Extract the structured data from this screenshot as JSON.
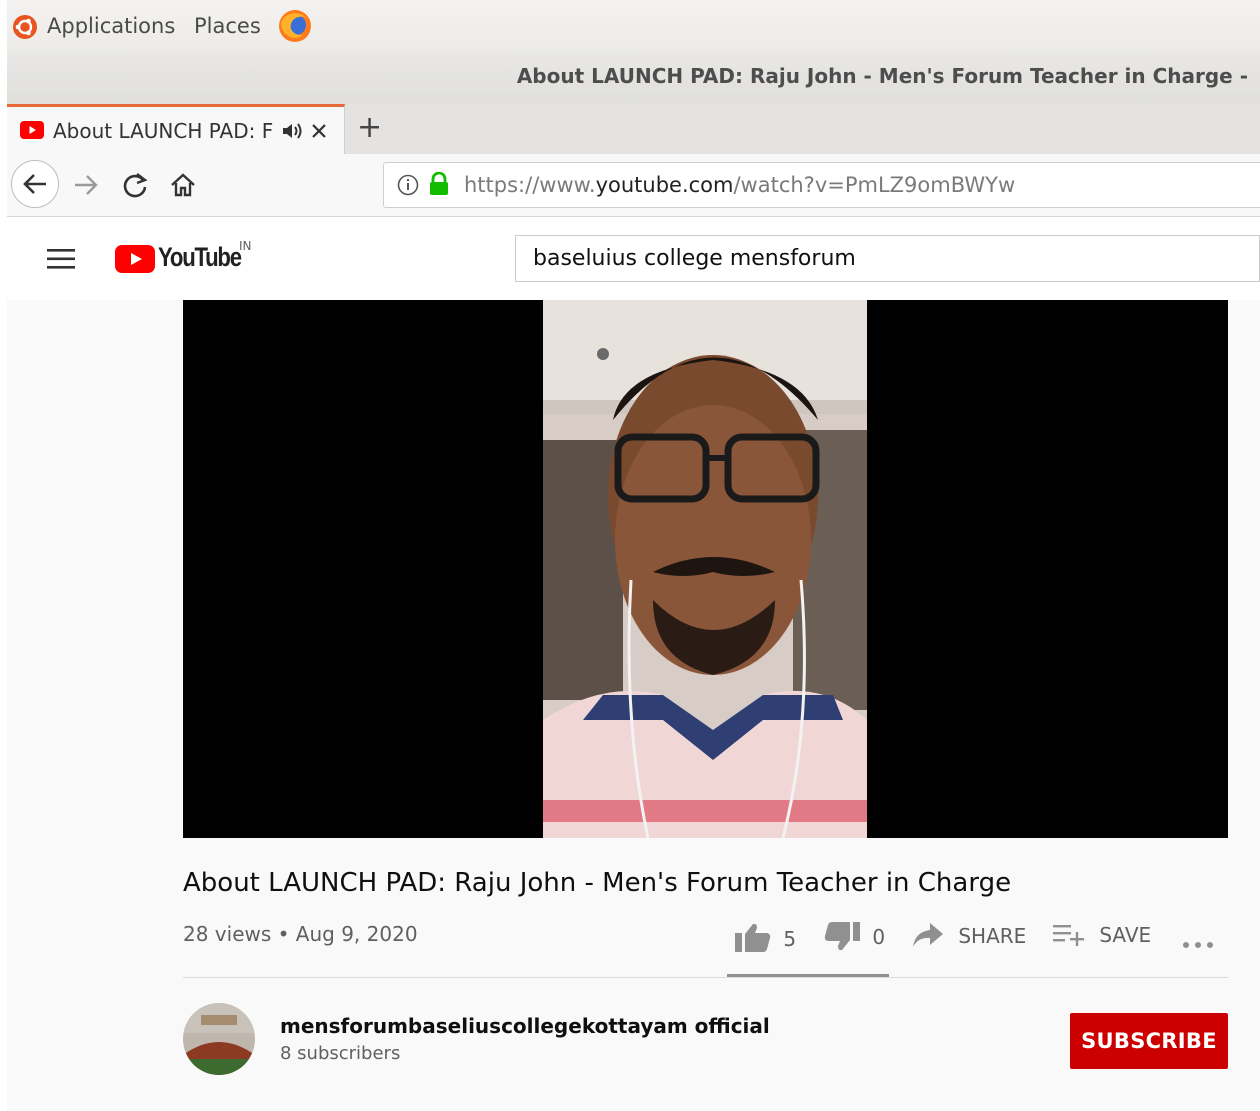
{
  "os_panel": {
    "applications_label": "Applications",
    "places_label": "Places"
  },
  "window": {
    "title": "About LAUNCH PAD: Raju John - Men's Forum Teacher in Charge - "
  },
  "browser": {
    "tab_title": "About LAUNCH PAD: F",
    "new_tab_label": "+",
    "url_prefix": "https://www.",
    "url_domain": "youtube.com",
    "url_path": "/watch?v=PmLZ9omBWYw"
  },
  "youtube": {
    "logo_text": "YouTube",
    "region": "IN",
    "search_value": "baseluius college mensforum",
    "video": {
      "title": "About LAUNCH PAD: Raju John - Men's Forum Teacher in Charge",
      "views": "28 views",
      "separator": "•",
      "date": "Aug 9, 2020",
      "likes": "5",
      "dislikes": "0",
      "share_label": "SHARE",
      "save_label": "SAVE"
    },
    "channel": {
      "name": "mensforumbaseliuscollegekottayam official",
      "subscribers": "8 subscribers",
      "subscribe_label": "SUBSCRIBE"
    }
  },
  "colors": {
    "youtube_red": "#ff0000",
    "subscribe_red": "#cc0000",
    "tab_accent": "#e66a3a"
  }
}
